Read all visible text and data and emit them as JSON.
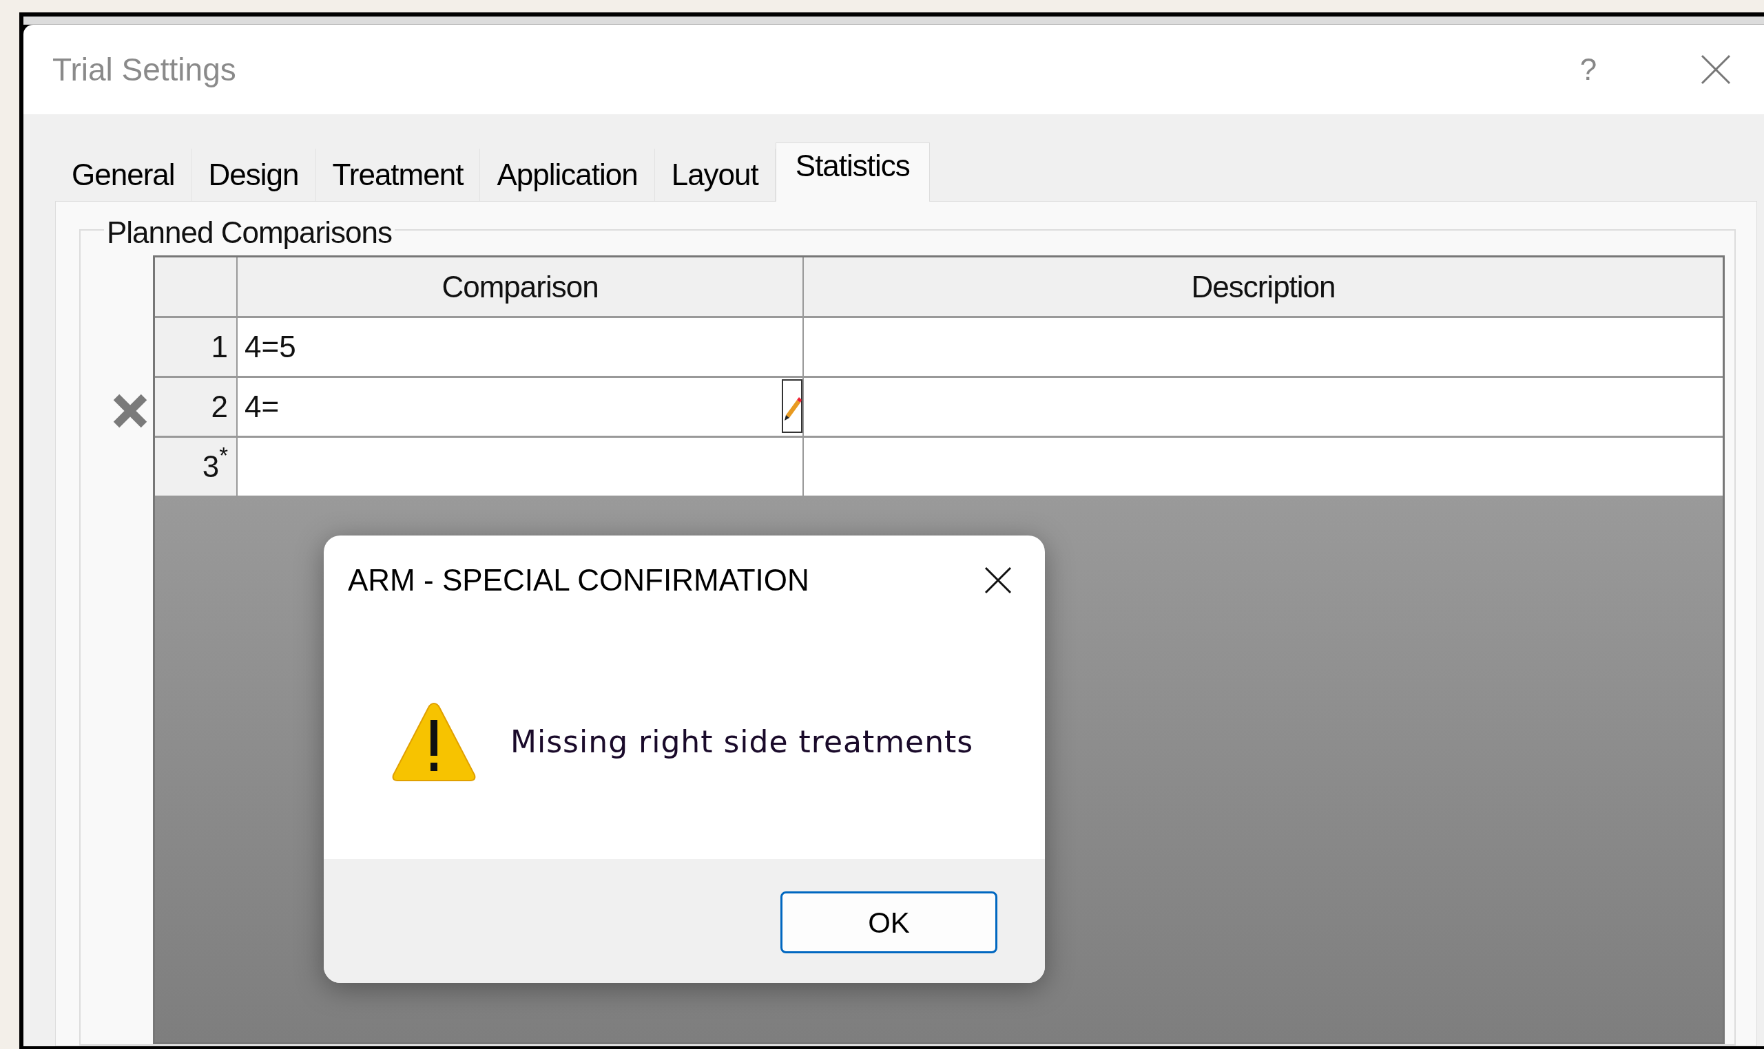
{
  "window": {
    "title": "Trial Settings",
    "help": "?"
  },
  "tabs": [
    {
      "label": "General",
      "selected": false
    },
    {
      "label": "Design",
      "selected": false
    },
    {
      "label": "Treatment",
      "selected": false
    },
    {
      "label": "Application",
      "selected": false
    },
    {
      "label": "Layout",
      "selected": false
    },
    {
      "label": "Statistics",
      "selected": true
    }
  ],
  "group": {
    "title": "Planned Comparisons"
  },
  "table": {
    "columns": [
      "Comparison",
      "Description"
    ],
    "rows": [
      {
        "number": "1",
        "comparison": "4=5",
        "editing": false
      },
      {
        "number": "2",
        "comparison": "4=",
        "editing": true
      },
      {
        "number": "3$^{*}$",
        "comparison": "",
        "editing": false
      }
    ]
  },
  "dialog": {
    "title": "ARM - SPECIAL CONFIRMATION",
    "message": "Missing right side treatments",
    "button": "OK"
  }
}
